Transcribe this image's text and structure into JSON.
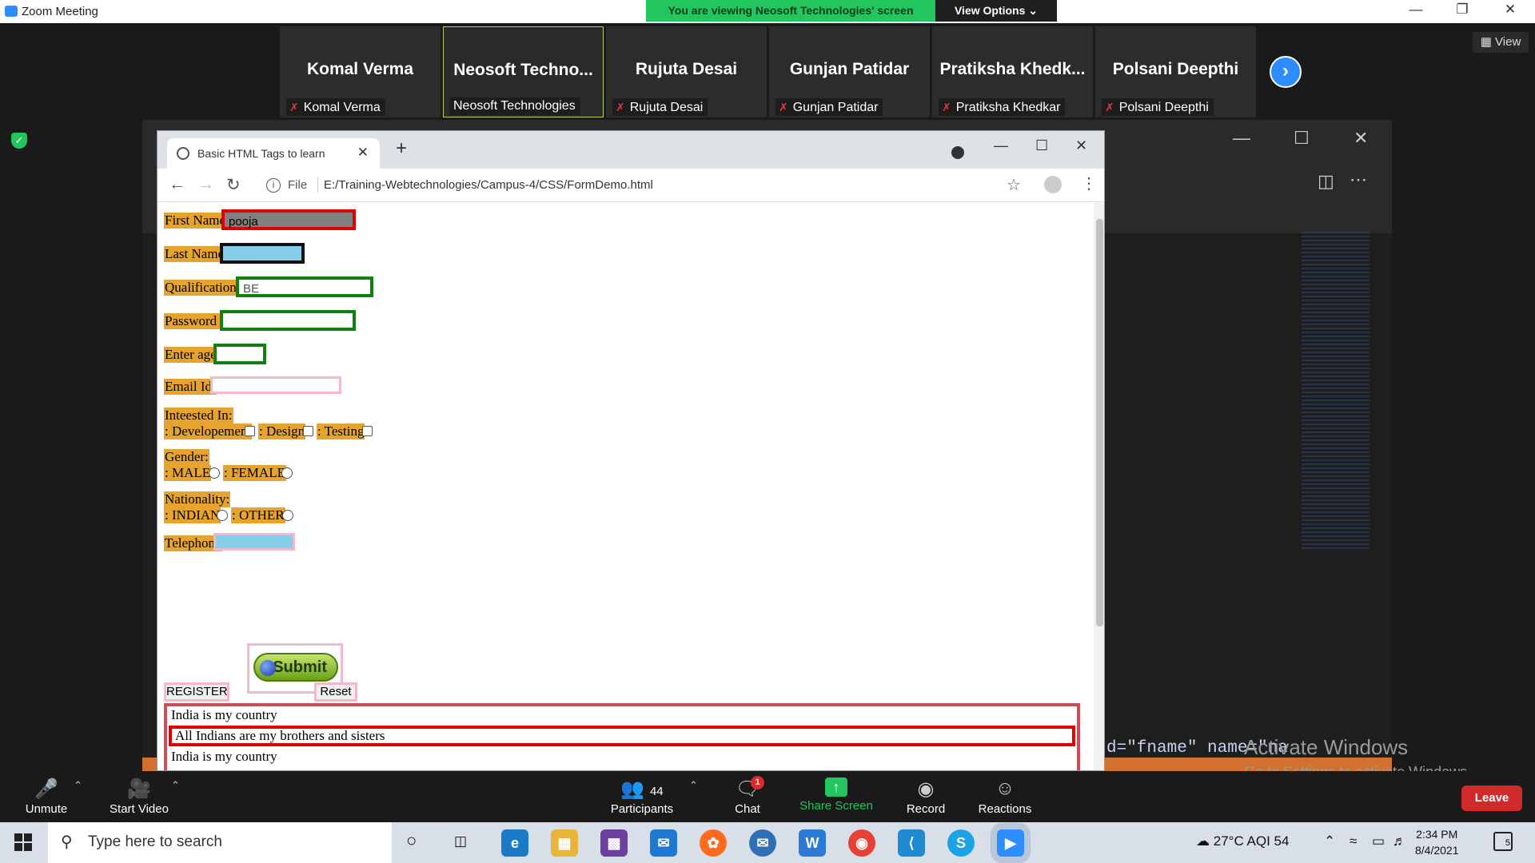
{
  "zoom": {
    "title": "Zoom Meeting",
    "banner": "You are viewing Neosoft Technologies' screen",
    "view_options": "View Options ⌄",
    "view_button": "View",
    "participants_tiles": [
      {
        "big": "Komal Verma",
        "small": "Komal Verma",
        "muted": true
      },
      {
        "big": "Neosoft  Techno...",
        "small": "Neosoft Technologies",
        "muted": false
      },
      {
        "big": "Rujuta Desai",
        "small": "Rujuta Desai",
        "muted": true
      },
      {
        "big": "Gunjan Patidar",
        "small": "Gunjan Patidar",
        "muted": true
      },
      {
        "big": "Pratiksha  Khedk...",
        "small": "Pratiksha Khedkar",
        "muted": true
      },
      {
        "big": "Polsani Deepthi",
        "small": "Polsani Deepthi",
        "muted": true
      }
    ],
    "toolbar": {
      "unmute": "Unmute",
      "start_video": "Start Video",
      "participants": "Participants",
      "participants_count": "44",
      "chat": "Chat",
      "chat_badge": "1",
      "share_screen": "Share Screen",
      "record": "Record",
      "reactions": "Reactions",
      "leave": "Leave"
    }
  },
  "shared": {
    "code_snippet": "d=\"fname\" name=\"na",
    "activate_title": "Activate Windows",
    "activate_sub": "Go to Settings to activate Windows."
  },
  "browser": {
    "tab_title": "Basic HTML Tags to learn",
    "file_label": "File",
    "url": "E:/Training-Webtechnologies/Campus-4/CSS/FormDemo.html"
  },
  "form": {
    "first_name_label": "First Name:",
    "first_name_value": "pooja",
    "last_name_label": "Last Name:",
    "qualification_label": "Qualification :",
    "qualification_value": "BE",
    "password_label": "Password :",
    "age_label": "Enter age:",
    "email_label": "Email Id:",
    "interested_label": "Inteested In:",
    "interests": [
      ": Developement",
      ": Design",
      ": Testing"
    ],
    "gender_label": "Gender:",
    "genders": [
      ": MALE",
      ": FEMALE"
    ],
    "nationality_label": "Nationality:",
    "nationalities": [
      ": INDIAN",
      ": OTHER"
    ],
    "telephone_label": "Telephone",
    "submit_label": "Submit",
    "register_label": "REGISTER",
    "reset_label": "Reset",
    "text_lines": [
      "India is my country",
      "All Indians are my brothers and sisters",
      "India is my country"
    ]
  },
  "taskbar": {
    "search_placeholder": "Type here to search",
    "weather": "27°C  AQI 54",
    "time": "2:34 PM",
    "date": "8/4/2021",
    "notifications": "5"
  },
  "colors": {
    "label_bg": "#e6a42e",
    "zoom_green": "#23c55e",
    "zoom_blue": "#2d8cff",
    "leave_red": "#d12a2a"
  }
}
